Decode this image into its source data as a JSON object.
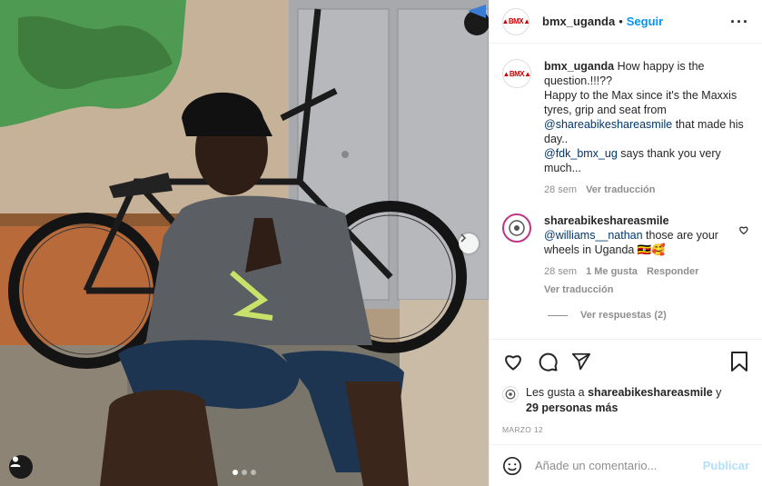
{
  "header": {
    "username": "bmx_uganda",
    "bullet": "•",
    "follow_label": "Seguir",
    "more_label": "···"
  },
  "caption": {
    "username": "bmx_uganda",
    "line1": " How happy is the question.!!!??",
    "line2": "Happy to the Max since it's the Maxxis tyres, grip and seat from ",
    "mention1": "@shareabikeshareasmile",
    "line2b": " that made his day..",
    "mention2": "@fdk_bmx_ug",
    "line3": " says thank you very much...",
    "time": "28 sem",
    "translate": "Ver traducción"
  },
  "comment": {
    "username": "shareabikeshareasmile",
    "mention": "@williams__nathan",
    "text": " those are your wheels in Uganda 🇺🇬🥰",
    "time": "28 sem",
    "likes": "1 Me gusta",
    "reply": "Responder",
    "translate": "Ver traducción",
    "view_replies": "Ver respuestas (2)"
  },
  "likes": {
    "prefix": "Les gusta a ",
    "user": "shareabikeshareasmile",
    "mid": " y",
    "others": "29 personas más"
  },
  "date": "MARZO 12",
  "add_comment": {
    "placeholder": "Añade un comentario...",
    "publish": "Publicar"
  },
  "carousel": {
    "slides": 3,
    "active": 1
  },
  "colors": {
    "accent": "#0095f6",
    "link": "#00376b",
    "muted": "#8e8e8e",
    "publish_disabled": "#b2dffc"
  }
}
